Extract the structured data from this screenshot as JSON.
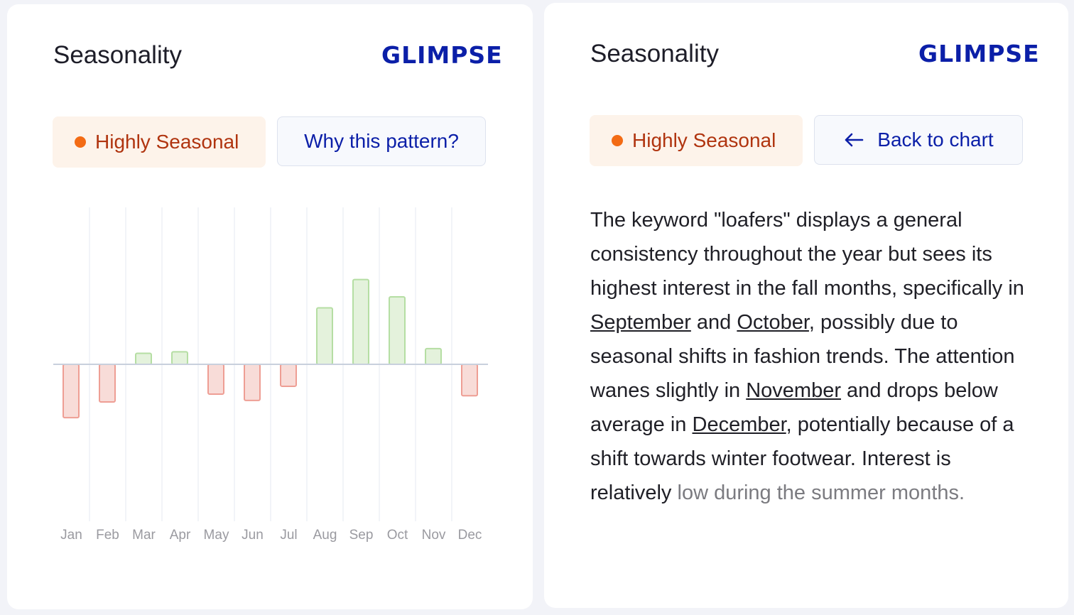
{
  "left_card": {
    "title": "Seasonality",
    "logo": "GLIMPSE",
    "badge": "Highly Seasonal",
    "button": "Why this pattern?"
  },
  "right_card": {
    "title": "Seasonality",
    "logo": "GLIMPSE",
    "badge": "Highly Seasonal",
    "button": "Back to chart",
    "button_icon": "arrow-left-icon",
    "text": {
      "p1": "The keyword \"loafers\" displays a general consistency throughout the year but sees its highest interest in the fall months, specifically in ",
      "l1": "September",
      "p2": " and ",
      "l2": "October",
      "p3": ", possibly due to seasonal shifts in fashion trends. The attention wanes slightly in ",
      "l3": "November",
      "p4": " and drops below average in ",
      "l4": "December",
      "p5": ", potentially because of a shift towards winter footwear. Interest is relatively ",
      "p6": "low during the summer months."
    }
  },
  "colors": {
    "accent": "#0b1fa8",
    "badge_dot": "#f36b14",
    "positive": "#b5dea3",
    "negative": "#ee9e94"
  },
  "chart_data": {
    "type": "bar",
    "categories": [
      "Jan",
      "Feb",
      "Mar",
      "Apr",
      "May",
      "Jun",
      "Jul",
      "Aug",
      "Sep",
      "Oct",
      "Nov",
      "Dec"
    ],
    "values": [
      -34,
      -24,
      7,
      8,
      -19,
      -23,
      -14,
      36,
      54,
      43,
      10,
      -20
    ],
    "ylim": [
      -100,
      100
    ],
    "grid": "vertical",
    "title": "",
    "xlabel": "",
    "ylabel": ""
  }
}
